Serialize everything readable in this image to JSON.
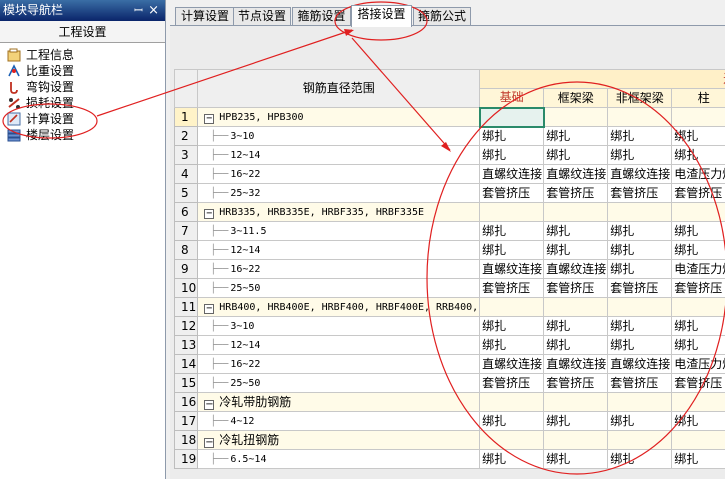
{
  "panel": {
    "title": "模块导航栏",
    "pin_glyph": "ꟷ",
    "close_glyph": "×",
    "header": "工程设置",
    "items": [
      {
        "label": "工程信息",
        "icon": "project-info-icon"
      },
      {
        "label": "比重设置",
        "icon": "weight-ratio-icon"
      },
      {
        "label": "弯钩设置",
        "icon": "hook-icon"
      },
      {
        "label": "损耗设置",
        "icon": "loss-icon"
      },
      {
        "label": "计算设置",
        "icon": "calculation-icon"
      },
      {
        "label": "楼层设置",
        "icon": "floor-icon"
      }
    ]
  },
  "tabs": [
    "计算设置",
    "节点设置",
    "箍筋设置",
    "搭接设置",
    "箍筋公式"
  ],
  "active_tab": "搭接设置",
  "grid": {
    "diameter_header": "钢筋直径范围",
    "group_header": "连接",
    "columns": [
      "基础",
      "框架梁",
      "非框架梁",
      "柱",
      ""
    ],
    "rows": [
      {
        "no": "1",
        "type": "group",
        "name": "HPB235, HPB300",
        "values": [
          "",
          "",
          "",
          "",
          ""
        ]
      },
      {
        "no": "2",
        "type": "item",
        "name": "3~10",
        "values": [
          "绑扎",
          "绑扎",
          "绑扎",
          "绑扎",
          "绑"
        ]
      },
      {
        "no": "3",
        "type": "item",
        "name": "12~14",
        "values": [
          "绑扎",
          "绑扎",
          "绑扎",
          "绑扎",
          "绑"
        ]
      },
      {
        "no": "4",
        "type": "item",
        "name": "16~22",
        "values": [
          "直螺纹连接",
          "直螺纹连接",
          "直螺纹连接",
          "电渣压力焊",
          "直"
        ]
      },
      {
        "no": "5",
        "type": "item",
        "name": "25~32",
        "values": [
          "套管挤压",
          "套管挤压",
          "套管挤压",
          "套管挤压",
          "套"
        ]
      },
      {
        "no": "6",
        "type": "group",
        "name": "HRB335, HRB335E, HRBF335, HRBF335E",
        "values": [
          "",
          "",
          "",
          "",
          ""
        ]
      },
      {
        "no": "7",
        "type": "item",
        "name": "3~11.5",
        "values": [
          "绑扎",
          "绑扎",
          "绑扎",
          "绑扎",
          "绑"
        ]
      },
      {
        "no": "8",
        "type": "item",
        "name": "12~14",
        "values": [
          "绑扎",
          "绑扎",
          "绑扎",
          "绑扎",
          "绑"
        ]
      },
      {
        "no": "9",
        "type": "item",
        "name": "16~22",
        "values": [
          "直螺纹连接",
          "直螺纹连接",
          "绑扎",
          "电渣压力焊",
          "直"
        ]
      },
      {
        "no": "10",
        "type": "item",
        "name": "25~50",
        "values": [
          "套管挤压",
          "套管挤压",
          "套管挤压",
          "套管挤压",
          "套"
        ]
      },
      {
        "no": "11",
        "type": "group",
        "name": "HRB400, HRB400E, HRBF400, HRBF400E, RRB400,",
        "values": [
          "",
          "",
          "",
          "",
          ""
        ]
      },
      {
        "no": "12",
        "type": "item",
        "name": "3~10",
        "values": [
          "绑扎",
          "绑扎",
          "绑扎",
          "绑扎",
          "绑"
        ]
      },
      {
        "no": "13",
        "type": "item",
        "name": "12~14",
        "values": [
          "绑扎",
          "绑扎",
          "绑扎",
          "绑扎",
          "绑"
        ]
      },
      {
        "no": "14",
        "type": "item",
        "name": "16~22",
        "values": [
          "直螺纹连接",
          "直螺纹连接",
          "直螺纹连接",
          "电渣压力焊",
          "直"
        ]
      },
      {
        "no": "15",
        "type": "item",
        "name": "25~50",
        "values": [
          "套管挤压",
          "套管挤压",
          "套管挤压",
          "套管挤压",
          "套"
        ]
      },
      {
        "no": "16",
        "type": "group",
        "name": "冷轧带肋钢筋",
        "values": [
          "",
          "",
          "",
          "",
          ""
        ]
      },
      {
        "no": "17",
        "type": "item",
        "name": "4~12",
        "values": [
          "绑扎",
          "绑扎",
          "绑扎",
          "绑扎",
          "绑"
        ]
      },
      {
        "no": "18",
        "type": "group",
        "name": "冷轧扭钢筋",
        "values": [
          "",
          "",
          "",
          "",
          ""
        ]
      },
      {
        "no": "19",
        "type": "item",
        "name": "6.5~14",
        "values": [
          "绑扎",
          "绑扎",
          "绑扎",
          "绑扎",
          "绑"
        ]
      }
    ]
  },
  "colors": {
    "annotation": "#e02020",
    "selection": "#2a8a6a",
    "group_row": "#fffbe8"
  }
}
